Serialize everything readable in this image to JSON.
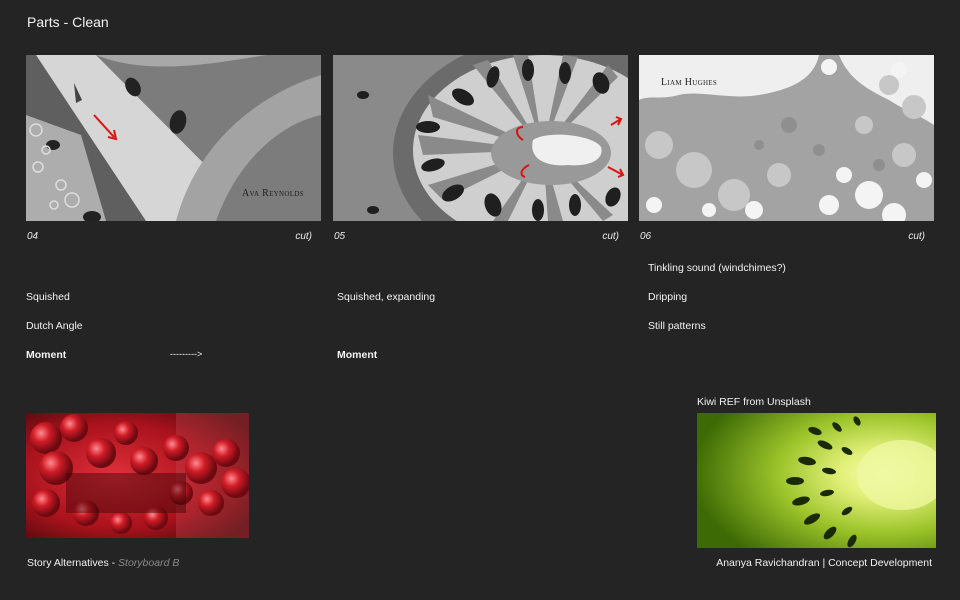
{
  "page": {
    "title": "Parts - Clean"
  },
  "panels": [
    {
      "number": "04",
      "cut": "cut)",
      "artist": "Ava Reynolds"
    },
    {
      "number": "05",
      "cut": "cut)"
    },
    {
      "number": "06",
      "cut": "cut)",
      "artist": "Liam Hughes"
    }
  ],
  "notes": {
    "col1": {
      "line1": "Squished",
      "line2": "Dutch Angle",
      "line3": "Moment",
      "arrow": "--------->"
    },
    "col2": {
      "line1": "Squished, expanding",
      "line3": "Moment"
    },
    "col3": {
      "line0": "Tinkling sound (windchimes?)",
      "line1": "Dripping",
      "line2": "Still patterns"
    }
  },
  "reference": {
    "label": "Kiwi REF from Unsplash"
  },
  "footer": {
    "left_main": "Story Alternatives - ",
    "left_sub": "Storyboard B",
    "right": "Ananya Ravichandran | Concept Development"
  }
}
